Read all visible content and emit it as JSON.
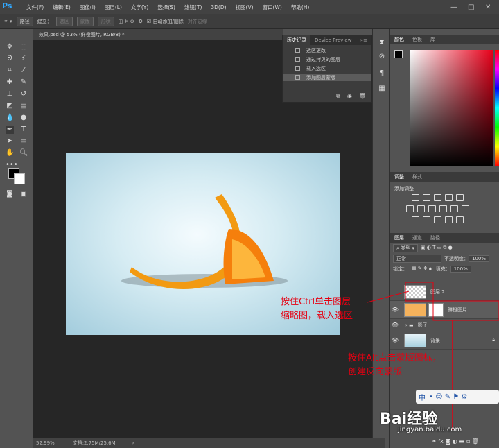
{
  "app": {
    "logo": "Ps",
    "menu": [
      "文件(F)",
      "编辑(E)",
      "图像(I)",
      "图层(L)",
      "文字(Y)",
      "选择(S)",
      "滤镜(T)",
      "3D(D)",
      "视图(V)",
      "窗口(W)",
      "帮助(H)"
    ],
    "window_controls": [
      "—",
      "□",
      "✕"
    ]
  },
  "options": {
    "mode": "路径",
    "make_label": "建立：",
    "selection": "选区",
    "mask": "蒙版",
    "shape": "形状",
    "auto_add_delete": "自动添加/删除",
    "align_edges": "对齐边缘"
  },
  "document": {
    "tab": "效果.psd @ 53% (鲜橙图片, RGB/8) *",
    "zoom": "52.99%",
    "doc_info": "文档:2.75M/25.6M"
  },
  "history": {
    "tabs": [
      "历史记录",
      "Device Preview"
    ],
    "items": [
      "选区更改",
      "通过拷贝的图层",
      "载入选区",
      "添加图层蒙版"
    ],
    "selected_index": 3
  },
  "color": {
    "tabs": [
      "颜色",
      "色板",
      "库"
    ],
    "hue_color": "#e8001a"
  },
  "adjustments": {
    "tabs": [
      "调整",
      "样式"
    ],
    "title": "添加调整"
  },
  "layers": {
    "tabs": [
      "图层",
      "通道",
      "路径"
    ],
    "filter": "类型",
    "blend": "正常",
    "opacity_label": "不透明度：",
    "opacity": "100%",
    "lock_label": "锁定：",
    "fill_label": "填充：",
    "fill": "100%",
    "items": [
      {
        "name": "图层 2"
      },
      {
        "name": "鲜橙图片"
      },
      {
        "name": "影子"
      },
      {
        "name": "背景"
      }
    ]
  },
  "annotations": {
    "line1": "按住Ctrl单击图层",
    "line2": "缩略图，载入选区",
    "line3": "按住Alt点击蒙版图标，",
    "line4": "创建反向蒙版",
    "color": "#e60012"
  },
  "watermark": {
    "brand": "Bai经验",
    "url": "jingyan.baidu.com",
    "ime": "中"
  }
}
